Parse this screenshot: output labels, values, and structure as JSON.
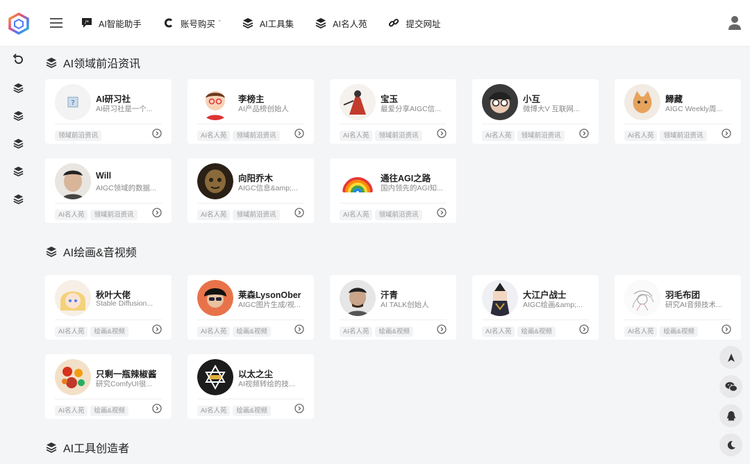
{
  "header": {
    "nav": [
      {
        "label": "AI智能助手",
        "icon": "ai-chat-icon"
      },
      {
        "label": "账号购买",
        "icon": "c-logo-icon",
        "caret": "ˇ"
      },
      {
        "label": "AI工具集",
        "icon": "layers-icon"
      },
      {
        "label": "AI名人苑",
        "icon": "layers-icon"
      },
      {
        "label": "提交网址",
        "icon": "link-icon"
      }
    ]
  },
  "sections": [
    {
      "title": "AI领域前沿资讯",
      "cards": [
        {
          "title": "AI研习社",
          "desc": "AI研习社是一个...",
          "tags": [
            "领域前沿资讯"
          ]
        },
        {
          "title": "李榜主",
          "desc": "AI产品榜创始人",
          "tags": [
            "AI名人苑",
            "领域前沿资讯"
          ]
        },
        {
          "title": "宝玉",
          "desc": "最爱分享AIGC信...",
          "tags": [
            "AI名人苑",
            "领域前沿资讯"
          ]
        },
        {
          "title": "小互",
          "desc": "微博大V 互联网...",
          "tags": [
            "AI名人苑",
            "领域前沿资讯"
          ]
        },
        {
          "title": "歸藏",
          "desc": "AIGC Weekly周...",
          "tags": [
            "AI名人苑",
            "领域前沿资讯"
          ]
        },
        {
          "title": "Will",
          "desc": "AIGC领域的数据...",
          "tags": [
            "AI名人苑",
            "领域前沿资讯"
          ]
        },
        {
          "title": "向阳乔木",
          "desc": "AIGC信息&amp;...",
          "tags": [
            "AI名人苑",
            "领域前沿资讯"
          ]
        },
        {
          "title": "通往AGI之路",
          "desc": "国内领先的AGI知...",
          "tags": [
            "AI名人苑",
            "领域前沿资讯"
          ]
        }
      ]
    },
    {
      "title": "AI绘画&音视频",
      "cards": [
        {
          "title": "秋叶大佬",
          "desc": "Stable Diffusion...",
          "tags": [
            "AI名人苑",
            "绘画&视频"
          ]
        },
        {
          "title": "莱森LysonOber",
          "desc": "AIGC图片生成/视...",
          "tags": [
            "AI名人苑",
            "绘画&视频"
          ]
        },
        {
          "title": "汗青",
          "desc": "AI TALK创始人",
          "tags": [
            "AI名人苑",
            "绘画&视频"
          ]
        },
        {
          "title": "大江户战士",
          "desc": "AIGC绘画&amp;...",
          "tags": [
            "AI名人苑",
            "绘画&视频"
          ]
        },
        {
          "title": "羽毛布团",
          "desc": "研究AI音频技术...",
          "tags": [
            "AI名人苑",
            "绘画&视频"
          ]
        },
        {
          "title": "只剩一瓶辣椒酱",
          "desc": "研究ComfyUI很...",
          "tags": [
            "AI名人苑",
            "绘画&视频"
          ]
        },
        {
          "title": "以太之尘",
          "desc": "AI视频转绘的技...",
          "tags": [
            "AI名人苑",
            "绘画&视频"
          ]
        }
      ]
    },
    {
      "title": "AI工具创造者",
      "cards": []
    }
  ],
  "colors": {
    "accent": "#222222",
    "tag_bg": "#f2f3f5",
    "page_bg": "#f4f5f7"
  }
}
